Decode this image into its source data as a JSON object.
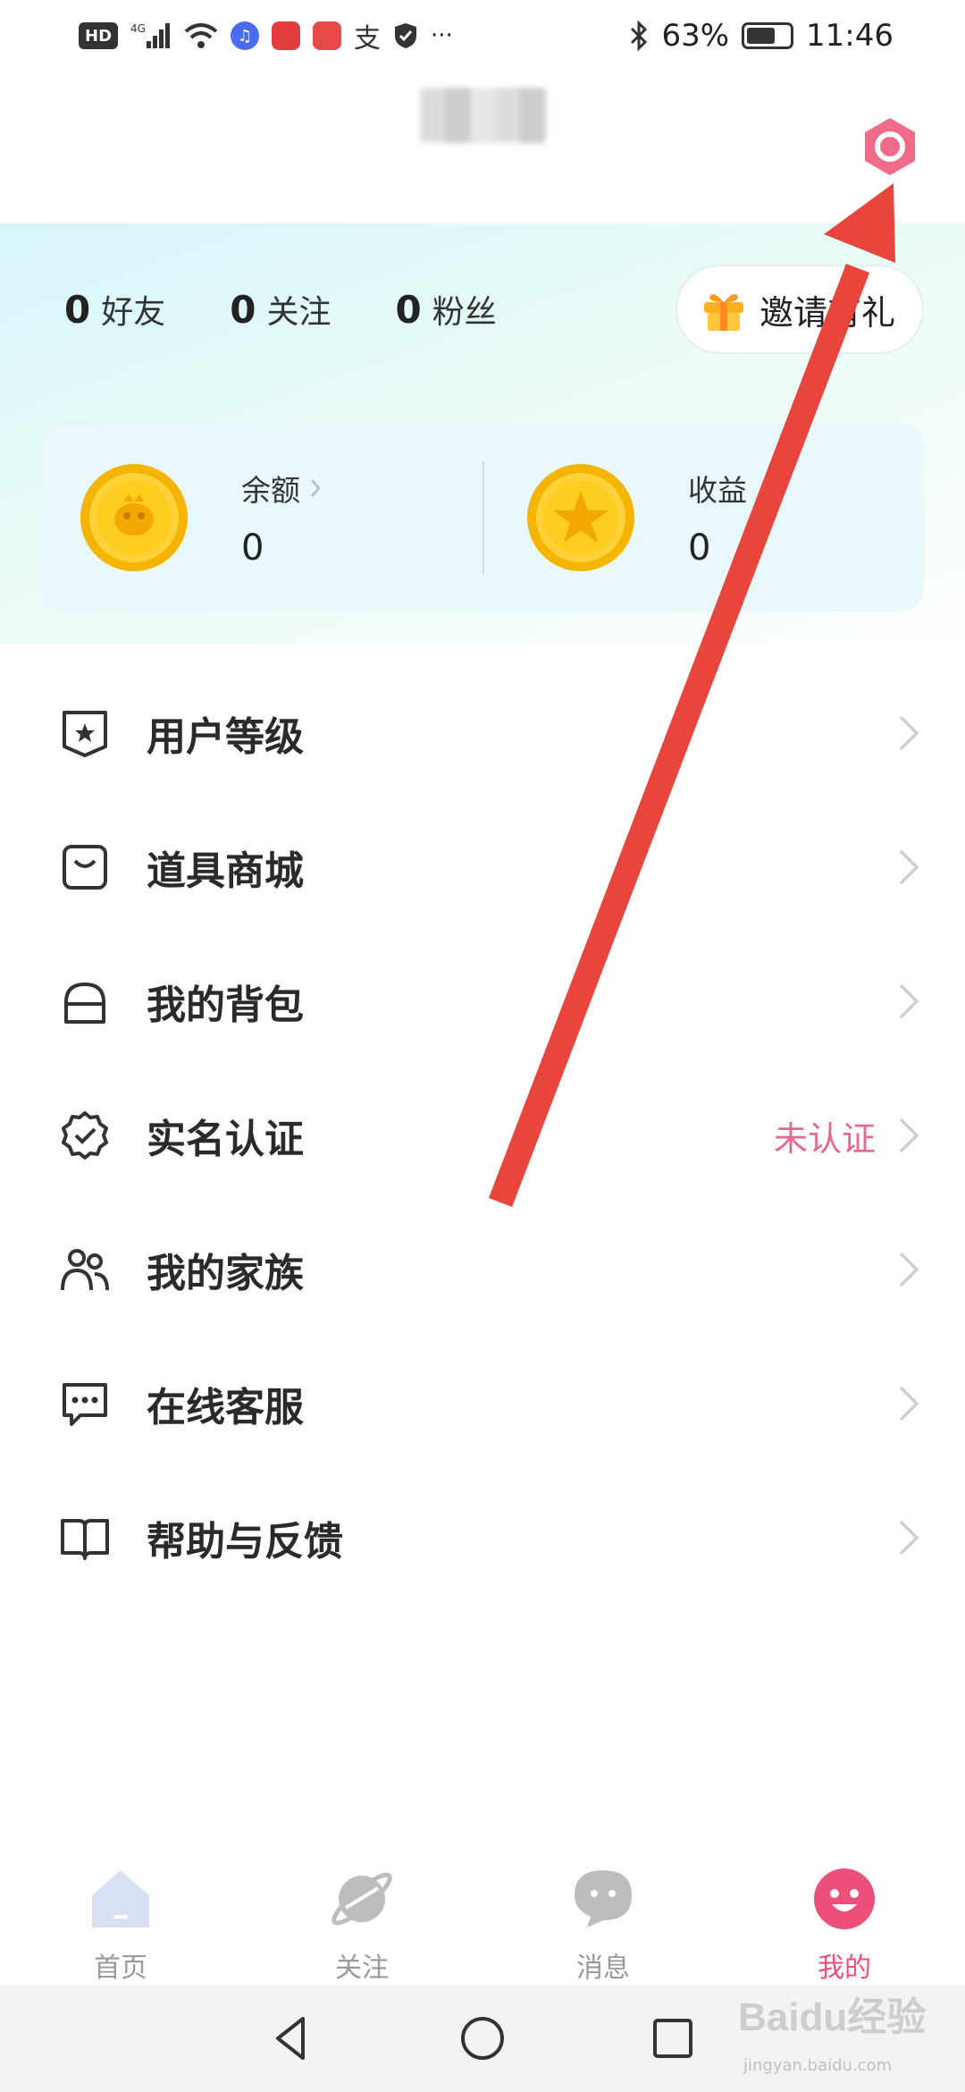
{
  "status_bar": {
    "network": "HD",
    "signal": "4G",
    "battery": "63%",
    "time": "11:46",
    "more": "···"
  },
  "stats": {
    "friends": {
      "count": "0",
      "label": "好友"
    },
    "following": {
      "count": "0",
      "label": "关注"
    },
    "fans": {
      "count": "0",
      "label": "粉丝"
    }
  },
  "invite": {
    "label": "邀请有礼"
  },
  "wallet": {
    "balance": {
      "label": "余额",
      "value": "0"
    },
    "earnings": {
      "label": "收益",
      "value": "0"
    }
  },
  "menu": [
    {
      "label": "用户等级",
      "icon": "shield-star-icon"
    },
    {
      "label": "道具商城",
      "icon": "shopping-bag-icon"
    },
    {
      "label": "我的背包",
      "icon": "backpack-icon"
    },
    {
      "label": "实名认证",
      "icon": "verified-badge-icon",
      "status": "未认证"
    },
    {
      "label": "我的家族",
      "icon": "family-icon"
    },
    {
      "label": "在线客服",
      "icon": "chat-bubble-icon"
    },
    {
      "label": "帮助与反馈",
      "icon": "book-icon"
    }
  ],
  "tabs": [
    {
      "label": "首页",
      "icon": "home-icon"
    },
    {
      "label": "关注",
      "icon": "planet-icon"
    },
    {
      "label": "消息",
      "icon": "message-icon"
    },
    {
      "label": "我的",
      "icon": "smiley-icon",
      "active": true
    }
  ],
  "watermark": {
    "text": "Baidu经验",
    "sub": "jingyan.baidu.com"
  },
  "colors": {
    "accent": "#ec4f7a",
    "status_pink": "#e8678a",
    "annotation_red": "#e8453c",
    "card_bg": "#e8f8fb"
  }
}
